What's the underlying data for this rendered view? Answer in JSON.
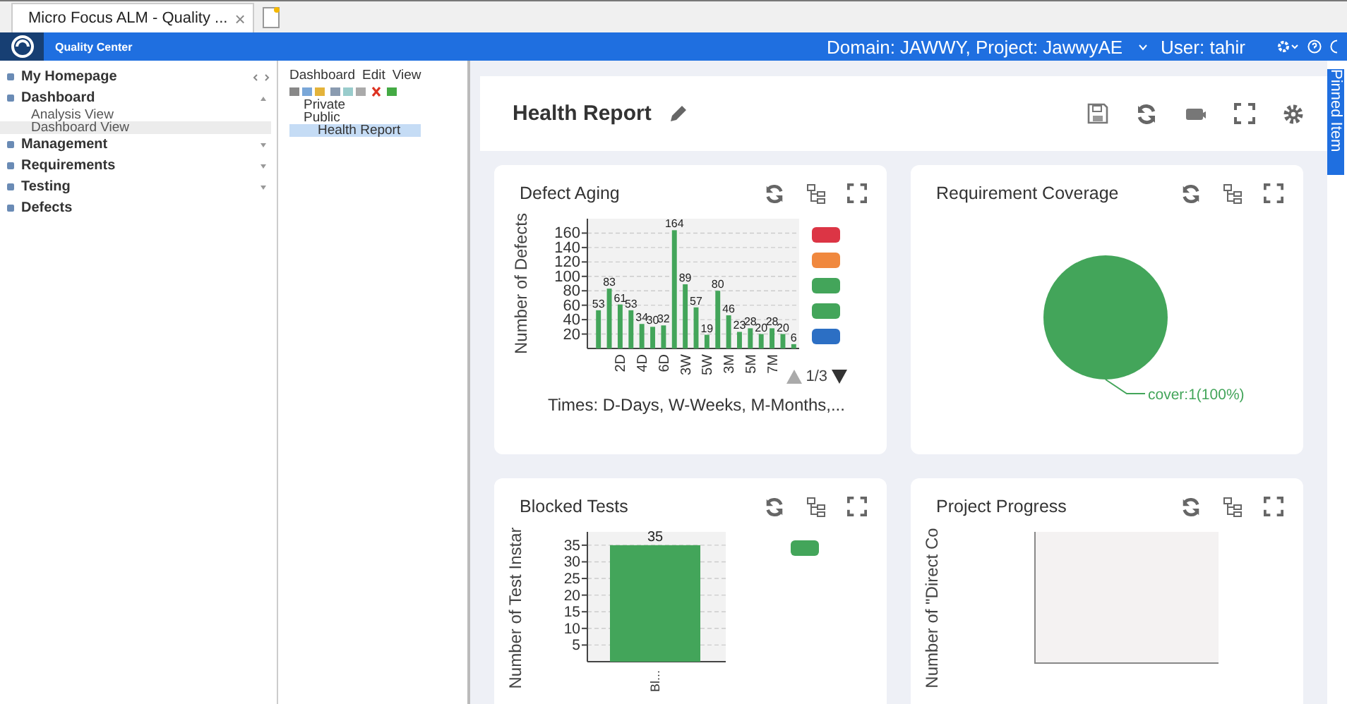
{
  "browser_tab": {
    "title": "Micro Focus ALM - Quality ...",
    "close": "×"
  },
  "header": {
    "product": "Quality Center",
    "context": "Domain: JAWWY, Project: JawwyAE",
    "user": "User: tahir"
  },
  "sidebar": {
    "items": [
      {
        "label": "My Homepage"
      },
      {
        "label": "Dashboard",
        "expanded": true,
        "children": [
          {
            "label": "Analysis View",
            "selected": false
          },
          {
            "label": "Dashboard View",
            "selected": true
          }
        ]
      },
      {
        "label": "Management",
        "expanded": false
      },
      {
        "label": "Requirements",
        "expanded": false
      },
      {
        "label": "Testing",
        "expanded": false
      },
      {
        "label": "Defects"
      }
    ]
  },
  "tree_panel": {
    "menu": [
      "Dashboard",
      "Edit",
      "View"
    ],
    "tree": [
      {
        "label": "Private",
        "selected": false
      },
      {
        "label": "Public",
        "selected": false,
        "expanded": true,
        "children": [
          {
            "label": "Health Report",
            "selected": true
          }
        ]
      }
    ]
  },
  "report": {
    "title": "Health Report"
  },
  "pinned_tab": {
    "label": "Pinned Item"
  },
  "cards": [
    {
      "kind": "bar-legend",
      "title": "Defect Aging",
      "pager": "1/3",
      "footer": "Times: D-Days, W-Weeks, M-Months,...",
      "legend": [
        {
          "color": "#dc3545"
        },
        {
          "color": "#f0883e"
        },
        {
          "color": "#43a55a"
        },
        {
          "color": "#43a55a"
        },
        {
          "color": "#2c6fc4"
        }
      ],
      "chart_data": {
        "type": "bar",
        "ylabel": "Number of Defects",
        "categories": [
          null,
          null,
          "2D",
          null,
          "4D",
          null,
          "6D",
          null,
          "3W",
          null,
          "5W",
          null,
          "3M",
          null,
          "5M",
          null,
          "7M",
          null,
          null
        ],
        "values": [
          53,
          83,
          61,
          53,
          34,
          30,
          32,
          164,
          89,
          57,
          19,
          80,
          46,
          23,
          28,
          20,
          28,
          20,
          6
        ],
        "yticks": [
          20,
          40,
          60,
          80,
          100,
          120,
          140,
          160
        ],
        "ylim": [
          0,
          180
        ],
        "grid": true,
        "data_labels": true
      }
    },
    {
      "kind": "pie",
      "title": "Requirement Coverage",
      "chart_data": {
        "type": "pie",
        "series": [
          {
            "color": "#43a55a",
            "values": [
              100
            ]
          }
        ],
        "value_labels": [
          "cover:1(100%)"
        ]
      }
    },
    {
      "kind": "bar",
      "title": "Blocked Tests",
      "legend": [
        {
          "color": "#43a55a"
        }
      ],
      "chart_data": {
        "type": "bar",
        "ylabel": "Number of Test Instar",
        "categories": [
          "Bl..."
        ],
        "values": [
          35
        ],
        "yticks": [
          5,
          10,
          15,
          20,
          25,
          30,
          35
        ],
        "ylim": [
          0,
          39
        ],
        "grid": true,
        "data_labels": true
      }
    },
    {
      "kind": "empty",
      "title": "Project Progress",
      "ylabel": "Number of \"Direct Co"
    }
  ]
}
